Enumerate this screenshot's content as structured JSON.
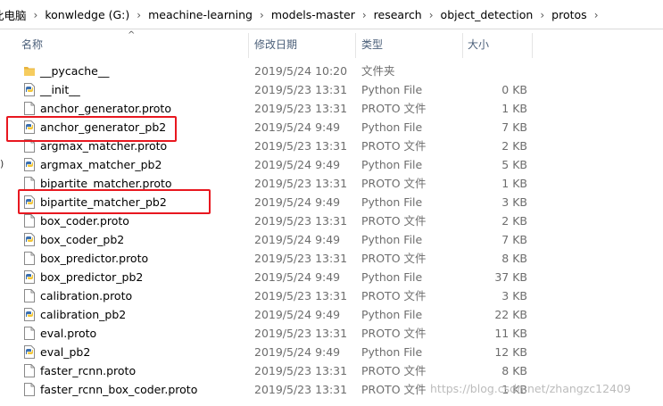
{
  "address": {
    "crumbs": [
      "此电脑",
      "konwledge (G:)",
      "meachine-learning",
      "models-master",
      "research",
      "object_detection",
      "protos"
    ],
    "separator": "›"
  },
  "header": {
    "sort_arrow": "^",
    "columns": {
      "name": "名称",
      "date": "修改日期",
      "type": "类型",
      "size": "大小"
    }
  },
  "left_edge_fragment": ")",
  "files": [
    {
      "name": "__pycache__",
      "date": "2019/5/24 10:20",
      "type": "文件夹",
      "size": "",
      "icon": "folder-icon"
    },
    {
      "name": "__init__",
      "date": "2019/5/23 13:31",
      "type": "Python File",
      "size": "0 KB",
      "icon": "python-file-icon"
    },
    {
      "name": "anchor_generator.proto",
      "date": "2019/5/23 13:31",
      "type": "PROTO 文件",
      "size": "1 KB",
      "icon": "document-icon"
    },
    {
      "name": "anchor_generator_pb2",
      "date": "2019/5/24 9:49",
      "type": "Python File",
      "size": "7 KB",
      "icon": "python-file-icon"
    },
    {
      "name": "argmax_matcher.proto",
      "date": "2019/5/23 13:31",
      "type": "PROTO 文件",
      "size": "2 KB",
      "icon": "document-icon"
    },
    {
      "name": "argmax_matcher_pb2",
      "date": "2019/5/24 9:49",
      "type": "Python File",
      "size": "5 KB",
      "icon": "python-file-icon"
    },
    {
      "name": "bipartite_matcher.proto",
      "date": "2019/5/23 13:31",
      "type": "PROTO 文件",
      "size": "1 KB",
      "icon": "document-icon"
    },
    {
      "name": "bipartite_matcher_pb2",
      "date": "2019/5/24 9:49",
      "type": "Python File",
      "size": "3 KB",
      "icon": "python-file-icon"
    },
    {
      "name": "box_coder.proto",
      "date": "2019/5/23 13:31",
      "type": "PROTO 文件",
      "size": "2 KB",
      "icon": "document-icon"
    },
    {
      "name": "box_coder_pb2",
      "date": "2019/5/24 9:49",
      "type": "Python File",
      "size": "7 KB",
      "icon": "python-file-icon"
    },
    {
      "name": "box_predictor.proto",
      "date": "2019/5/23 13:31",
      "type": "PROTO 文件",
      "size": "8 KB",
      "icon": "document-icon"
    },
    {
      "name": "box_predictor_pb2",
      "date": "2019/5/24 9:49",
      "type": "Python File",
      "size": "37 KB",
      "icon": "python-file-icon"
    },
    {
      "name": "calibration.proto",
      "date": "2019/5/23 13:31",
      "type": "PROTO 文件",
      "size": "3 KB",
      "icon": "document-icon"
    },
    {
      "name": "calibration_pb2",
      "date": "2019/5/24 9:49",
      "type": "Python File",
      "size": "22 KB",
      "icon": "python-file-icon"
    },
    {
      "name": "eval.proto",
      "date": "2019/5/23 13:31",
      "type": "PROTO 文件",
      "size": "11 KB",
      "icon": "document-icon"
    },
    {
      "name": "eval_pb2",
      "date": "2019/5/24 9:49",
      "type": "Python File",
      "size": "12 KB",
      "icon": "python-file-icon"
    },
    {
      "name": "faster_rcnn.proto",
      "date": "2019/5/23 13:31",
      "type": "PROTO 文件",
      "size": "8 KB",
      "icon": "document-icon"
    },
    {
      "name": "faster_rcnn_box_coder.proto",
      "date": "2019/5/23 13:31",
      "type": "PROTO 文件",
      "size": "1 KB",
      "icon": "document-icon"
    }
  ],
  "highlighted_files": [
    "anchor_generator_pb2",
    "bipartite_matcher_pb2"
  ],
  "watermark": "https://blog.csdn.net/zhangzc12409",
  "colors": {
    "highlight": "#e8171f",
    "header_text": "#4c607a",
    "secondary_text": "#6d6d6d",
    "folder": "#e8b33c",
    "python_blue": "#3a6fb0",
    "python_yellow": "#f3c636"
  }
}
